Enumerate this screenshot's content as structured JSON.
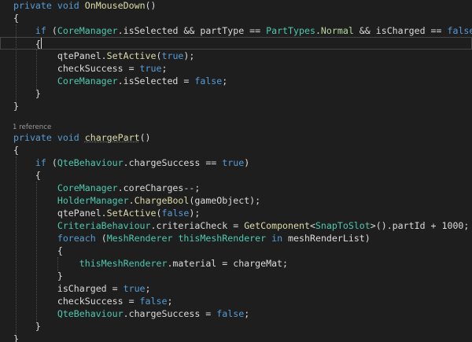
{
  "editor": {
    "colors": {
      "background": "#1e1e1e",
      "keyword": "#569cd6",
      "type": "#4ec9b0",
      "method": "#dcdcaa",
      "enum_member": "#b8d7a3",
      "plain": "#dcdcdc",
      "codelens": "#999999",
      "current_line_border": "#464646"
    },
    "codelens": "1 reference",
    "lines": [
      [
        [
          "k",
          "private"
        ],
        [
          "p",
          " "
        ],
        [
          "k",
          "void"
        ],
        [
          "p",
          " "
        ],
        [
          "m",
          "OnMouseDown"
        ],
        [
          "p",
          "()"
        ]
      ],
      [
        [
          "p",
          "{"
        ]
      ],
      [
        [
          "p",
          "    "
        ],
        [
          "k",
          "if"
        ],
        [
          "p",
          " ("
        ],
        [
          "c",
          "CoreManager"
        ],
        [
          "p",
          ".isSelected && partType == "
        ],
        [
          "c",
          "PartTypes"
        ],
        [
          "p",
          "."
        ],
        [
          "e",
          "Normal"
        ],
        [
          "p",
          " && isCharged == "
        ],
        [
          "k",
          "false"
        ],
        [
          "p",
          ")"
        ]
      ],
      [
        [
          "p",
          "    {"
        ]
      ],
      [
        [
          "p",
          "        qtePanel."
        ],
        [
          "m",
          "SetActive"
        ],
        [
          "p",
          "("
        ],
        [
          "k",
          "true"
        ],
        [
          "p",
          ");"
        ]
      ],
      [
        [
          "p",
          "        checkSuccess = "
        ],
        [
          "k",
          "true"
        ],
        [
          "p",
          ";"
        ]
      ],
      [
        [
          "p",
          "        "
        ],
        [
          "c",
          "CoreManager"
        ],
        [
          "p",
          ".isSelected = "
        ],
        [
          "k",
          "false"
        ],
        [
          "p",
          ";"
        ]
      ],
      [
        [
          "p",
          "    }"
        ]
      ],
      [
        [
          "p",
          "}"
        ]
      ],
      [
        [
          "p",
          ""
        ]
      ],
      [
        [
          "k",
          "private"
        ],
        [
          "p",
          " "
        ],
        [
          "k",
          "void"
        ],
        [
          "p",
          " "
        ],
        [
          "m",
          "chargePart"
        ],
        [
          "p",
          "()"
        ]
      ],
      [
        [
          "p",
          "{"
        ]
      ],
      [
        [
          "p",
          "    "
        ],
        [
          "k",
          "if"
        ],
        [
          "p",
          " ("
        ],
        [
          "c",
          "QteBehaviour"
        ],
        [
          "p",
          ".chargeSuccess == "
        ],
        [
          "k",
          "true"
        ],
        [
          "p",
          ")"
        ]
      ],
      [
        [
          "p",
          "    {"
        ]
      ],
      [
        [
          "p",
          "        "
        ],
        [
          "c",
          "CoreManager"
        ],
        [
          "p",
          ".coreCharges--;"
        ]
      ],
      [
        [
          "p",
          "        "
        ],
        [
          "c",
          "HolderManager"
        ],
        [
          "p",
          "."
        ],
        [
          "m",
          "ChargeBool"
        ],
        [
          "p",
          "(gameObject);"
        ]
      ],
      [
        [
          "p",
          "        qtePanel."
        ],
        [
          "m",
          "SetActive"
        ],
        [
          "p",
          "("
        ],
        [
          "k",
          "false"
        ],
        [
          "p",
          ");"
        ]
      ],
      [
        [
          "p",
          "        "
        ],
        [
          "c",
          "CriteriaBehaviour"
        ],
        [
          "p",
          ".criteriaCheck = "
        ],
        [
          "m",
          "GetComponent"
        ],
        [
          "p",
          "<"
        ],
        [
          "c",
          "SnapToSlot"
        ],
        [
          "p",
          ">().partId + 1000;"
        ]
      ],
      [
        [
          "p",
          "        "
        ],
        [
          "k",
          "foreach"
        ],
        [
          "p",
          " ("
        ],
        [
          "c",
          "MeshRenderer"
        ],
        [
          "p",
          " "
        ],
        [
          "c",
          "thisMeshRenderer"
        ],
        [
          "p",
          " "
        ],
        [
          "k",
          "in"
        ],
        [
          "p",
          " meshRenderList)"
        ]
      ],
      [
        [
          "p",
          "        {"
        ]
      ],
      [
        [
          "p",
          "            "
        ],
        [
          "c",
          "thisMeshRenderer"
        ],
        [
          "p",
          ".material = chargeMat;"
        ]
      ],
      [
        [
          "p",
          "        }"
        ]
      ],
      [
        [
          "p",
          "        isCharged = "
        ],
        [
          "k",
          "true"
        ],
        [
          "p",
          ";"
        ]
      ],
      [
        [
          "p",
          "        checkSuccess = "
        ],
        [
          "k",
          "false"
        ],
        [
          "p",
          ";"
        ]
      ],
      [
        [
          "p",
          "        "
        ],
        [
          "c",
          "QteBehaviour"
        ],
        [
          "p",
          ".chargeSuccess = "
        ],
        [
          "k",
          "false"
        ],
        [
          "p",
          ";"
        ]
      ],
      [
        [
          "p",
          "    }"
        ]
      ],
      [
        [
          "p",
          "}"
        ]
      ]
    ]
  }
}
